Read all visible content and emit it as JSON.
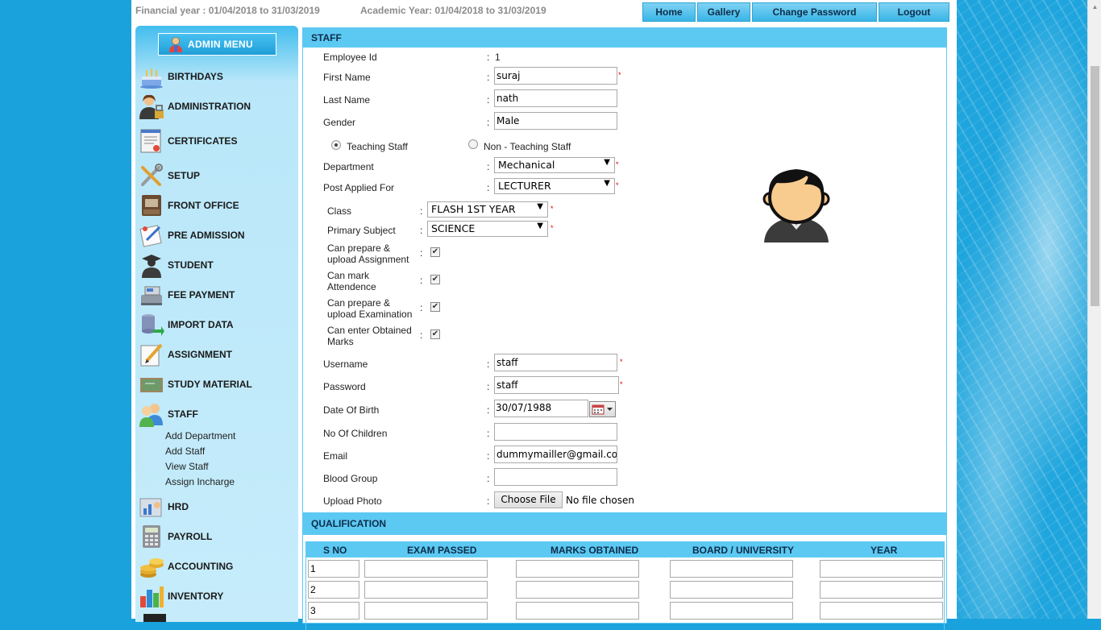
{
  "header": {
    "financial_year": "Financial year : 01/04/2018 to 31/03/2019",
    "academic_year": "Academic Year: 01/04/2018 to 31/03/2019",
    "nav": [
      "Home",
      "Gallery",
      "Change Password",
      "Logout"
    ]
  },
  "sidebar": {
    "admin_menu": "ADMIN MENU",
    "items": [
      {
        "label": "BIRTHDAYS",
        "icon": "cake-icon"
      },
      {
        "label": "ADMINISTRATION",
        "icon": "admin-user-icon"
      },
      {
        "label": "CERTIFICATES",
        "icon": "certificate-icon"
      },
      {
        "label": "SETUP",
        "icon": "tools-icon"
      },
      {
        "label": "FRONT OFFICE",
        "icon": "front-office-icon"
      },
      {
        "label": "PRE ADMISSION",
        "icon": "pre-admission-icon"
      },
      {
        "label": "STUDENT",
        "icon": "student-icon"
      },
      {
        "label": "FEE PAYMENT",
        "icon": "cash-register-icon"
      },
      {
        "label": "IMPORT DATA",
        "icon": "database-import-icon"
      },
      {
        "label": "ASSIGNMENT",
        "icon": "pencil-paper-icon"
      },
      {
        "label": "STUDY MATERIAL",
        "icon": "chalkboard-icon"
      },
      {
        "label": "STAFF",
        "icon": "staff-users-icon"
      },
      {
        "label": "HRD",
        "icon": "hrd-icon"
      },
      {
        "label": "PAYROLL",
        "icon": "calculator-icon"
      },
      {
        "label": "ACCOUNTING",
        "icon": "coins-icon"
      },
      {
        "label": "INVENTORY",
        "icon": "bar-chart-icon"
      }
    ],
    "staff_submenu": [
      "Add Department",
      "Add Staff",
      "View Staff",
      "Assign Incharge"
    ]
  },
  "staff_form": {
    "section_title": "STAFF",
    "employee_id_label": "Employee Id",
    "employee_id": "1",
    "first_name_label": "First Name",
    "first_name": "suraj",
    "last_name_label": "Last Name",
    "last_name": "nath",
    "gender_label": "Gender",
    "gender": "Male",
    "staff_type_options": [
      "Teaching Staff",
      "Non - Teaching Staff"
    ],
    "staff_type_selected": "Teaching Staff",
    "department_label": "Department",
    "department": "Mechanical",
    "post_label": "Post Applied For",
    "post": "LECTURER",
    "class_label": "Class",
    "class": "FLASH 1ST YEAR",
    "subject_label": "Primary Subject",
    "subject": "SCIENCE",
    "permissions": [
      {
        "line1": "Can prepare &",
        "line2": "upload Assignment",
        "checked": true
      },
      {
        "line1": "Can mark",
        "line2": "Attendence",
        "checked": true
      },
      {
        "line1": "Can prepare &",
        "line2": "upload Examination",
        "checked": true
      },
      {
        "line1": "Can enter Obtained",
        "line2": "Marks",
        "checked": true
      }
    ],
    "username_label": "Username",
    "username": "staff",
    "password_label": "Password",
    "password": "staff",
    "dob_label": "Date Of Birth",
    "dob": "30/07/1988",
    "children_label": "No Of Children",
    "children": "",
    "email_label": "Email",
    "email": "dummymailler@gmail.com",
    "blood_label": "Blood Group",
    "blood": "",
    "photo_label": "Upload Photo",
    "choose_file": "Choose File",
    "no_file": "No file chosen",
    "colon": ":",
    "required_mark": "*",
    "checkmark": "✔",
    "dropdown_arrow": "▼"
  },
  "qualification": {
    "section_title": "QUALIFICATION",
    "columns": [
      "S NO",
      "EXAM PASSED",
      "MARKS OBTAINED",
      "BOARD / UNIVERSITY",
      "YEAR"
    ],
    "rows": [
      "1",
      "2",
      "3"
    ]
  }
}
